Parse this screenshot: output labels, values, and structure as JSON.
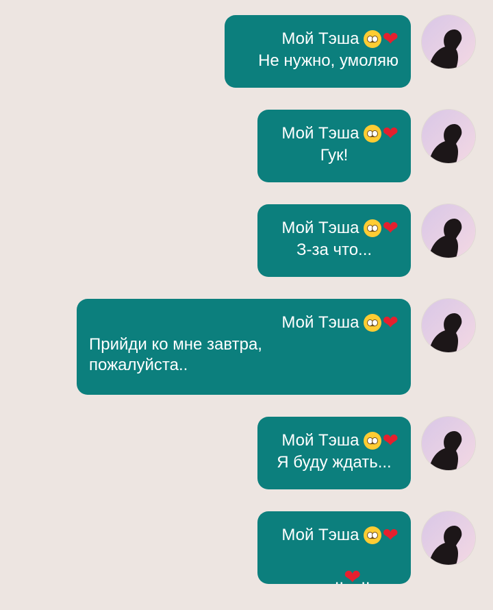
{
  "sender": {
    "name": "Мой Тэша",
    "emoji_face": "pleading-face",
    "emoji_heart": "❤"
  },
  "colors": {
    "background": "#ede5e1",
    "bubble": "#0c7f7d",
    "text": "#ffffff",
    "heart": "#e5202e"
  },
  "messages": [
    {
      "text": "Не нужно, умоляю"
    },
    {
      "text": "Гук!"
    },
    {
      "text": "З-за что..."
    },
    {
      "text": "Прийди ко мне завтра,\nпожалуйста.."
    },
    {
      "text": "Я буду ждать..."
    },
    {
      "text_before": "..",
      "heart": "❤",
      "text_after": ".."
    }
  ]
}
